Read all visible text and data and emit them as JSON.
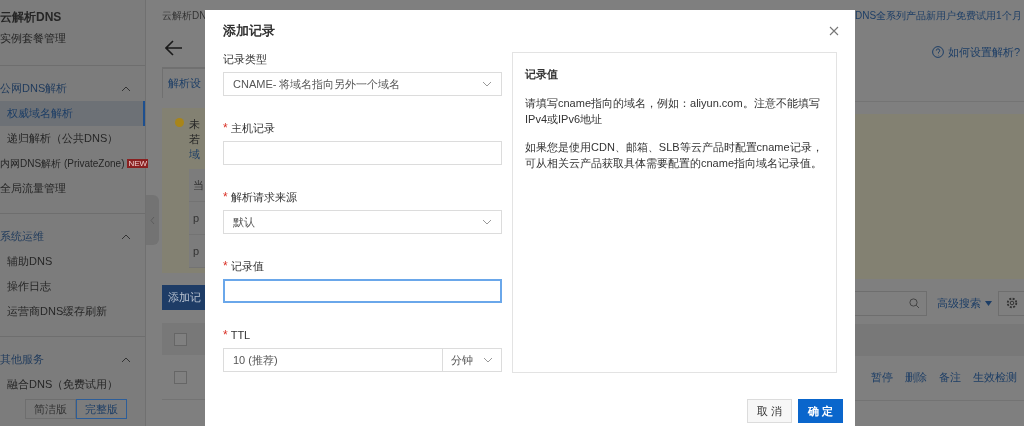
{
  "sidebar": {
    "title": "云解析DNS",
    "sections": [
      {
        "items": [
          {
            "label": "实例套餐管理",
            "kind": "top",
            "selected": false
          }
        ]
      },
      {
        "title": "公网DNS解析",
        "expanded": true,
        "items": [
          {
            "label": "权威域名解析",
            "kind": "sub",
            "selected": true
          },
          {
            "label": "递归解析（公共DNS）",
            "kind": "sub",
            "selected": false
          },
          {
            "label": "内网DNS解析 (PrivateZone)",
            "kind": "top",
            "selected": false,
            "badge": "NEW"
          },
          {
            "label": "全局流量管理",
            "kind": "top",
            "selected": false
          }
        ]
      },
      {
        "title": "系统运维",
        "expanded": true,
        "items": [
          {
            "label": "辅助DNS",
            "kind": "sub",
            "selected": false
          },
          {
            "label": "操作日志",
            "kind": "sub",
            "selected": false
          },
          {
            "label": "运营商DNS缓存刷新",
            "kind": "sub",
            "selected": false
          }
        ]
      },
      {
        "title": "其他服务",
        "expanded": true,
        "items": [
          {
            "label": "融合DNS（免费试用）",
            "kind": "sub",
            "selected": false
          }
        ],
        "editions": [
          {
            "label": "简洁版",
            "selected": false
          },
          {
            "label": "完整版",
            "selected": true
          }
        ]
      }
    ]
  },
  "background": {
    "breadcrumb": "云解析DN",
    "tab": "解析设",
    "notice_lines": [
      {
        "text": "未",
        "kind": "plain"
      },
      {
        "text": "若",
        "kind": "plain"
      },
      {
        "text": "域",
        "kind": "link"
      }
    ],
    "notice_rows": [
      "当",
      "p",
      "p"
    ],
    "checkboxes": [
      {
        "checked": false
      },
      {
        "checked": false
      }
    ],
    "add_button": "添加记",
    "promo": "DNS全系列产品新用户免费试用1个月",
    "help_link": "如何设置解析?",
    "advanced_search": "高级搜索",
    "row_actions": [
      "暂停",
      "删除",
      "备注",
      "生效检测"
    ]
  },
  "dialog": {
    "title": "添加记录",
    "fields": [
      {
        "kind": "select",
        "label": "记录类型",
        "value": "CNAME- 将域名指向另外一个域名"
      },
      {
        "kind": "input",
        "label": "主机记录",
        "mark": "*",
        "focused": false
      },
      {
        "kind": "select",
        "label": "解析请求来源",
        "mark": "*",
        "value": "默认"
      },
      {
        "kind": "input",
        "label": "记录值",
        "mark": "*",
        "focused": true
      },
      {
        "kind": "ttl",
        "label": "TTL",
        "mark": "*",
        "value": "10 (推荐)",
        "unit": "分钟"
      }
    ],
    "help": {
      "title": "记录值",
      "paragraphs": [
        "请填写cname指向的域名，例如：aliyun.com。注意不能填写IPv4或IPv6地址",
        "如果您是使用CDN、邮箱、SLB等云产品时配置cname记录，可从相关云产品获取具体需要配置的cname指向域名记录值。"
      ]
    },
    "buttons": [
      {
        "label": "取 消",
        "kind": "secondary"
      },
      {
        "label": "确 定",
        "kind": "primary"
      }
    ]
  }
}
